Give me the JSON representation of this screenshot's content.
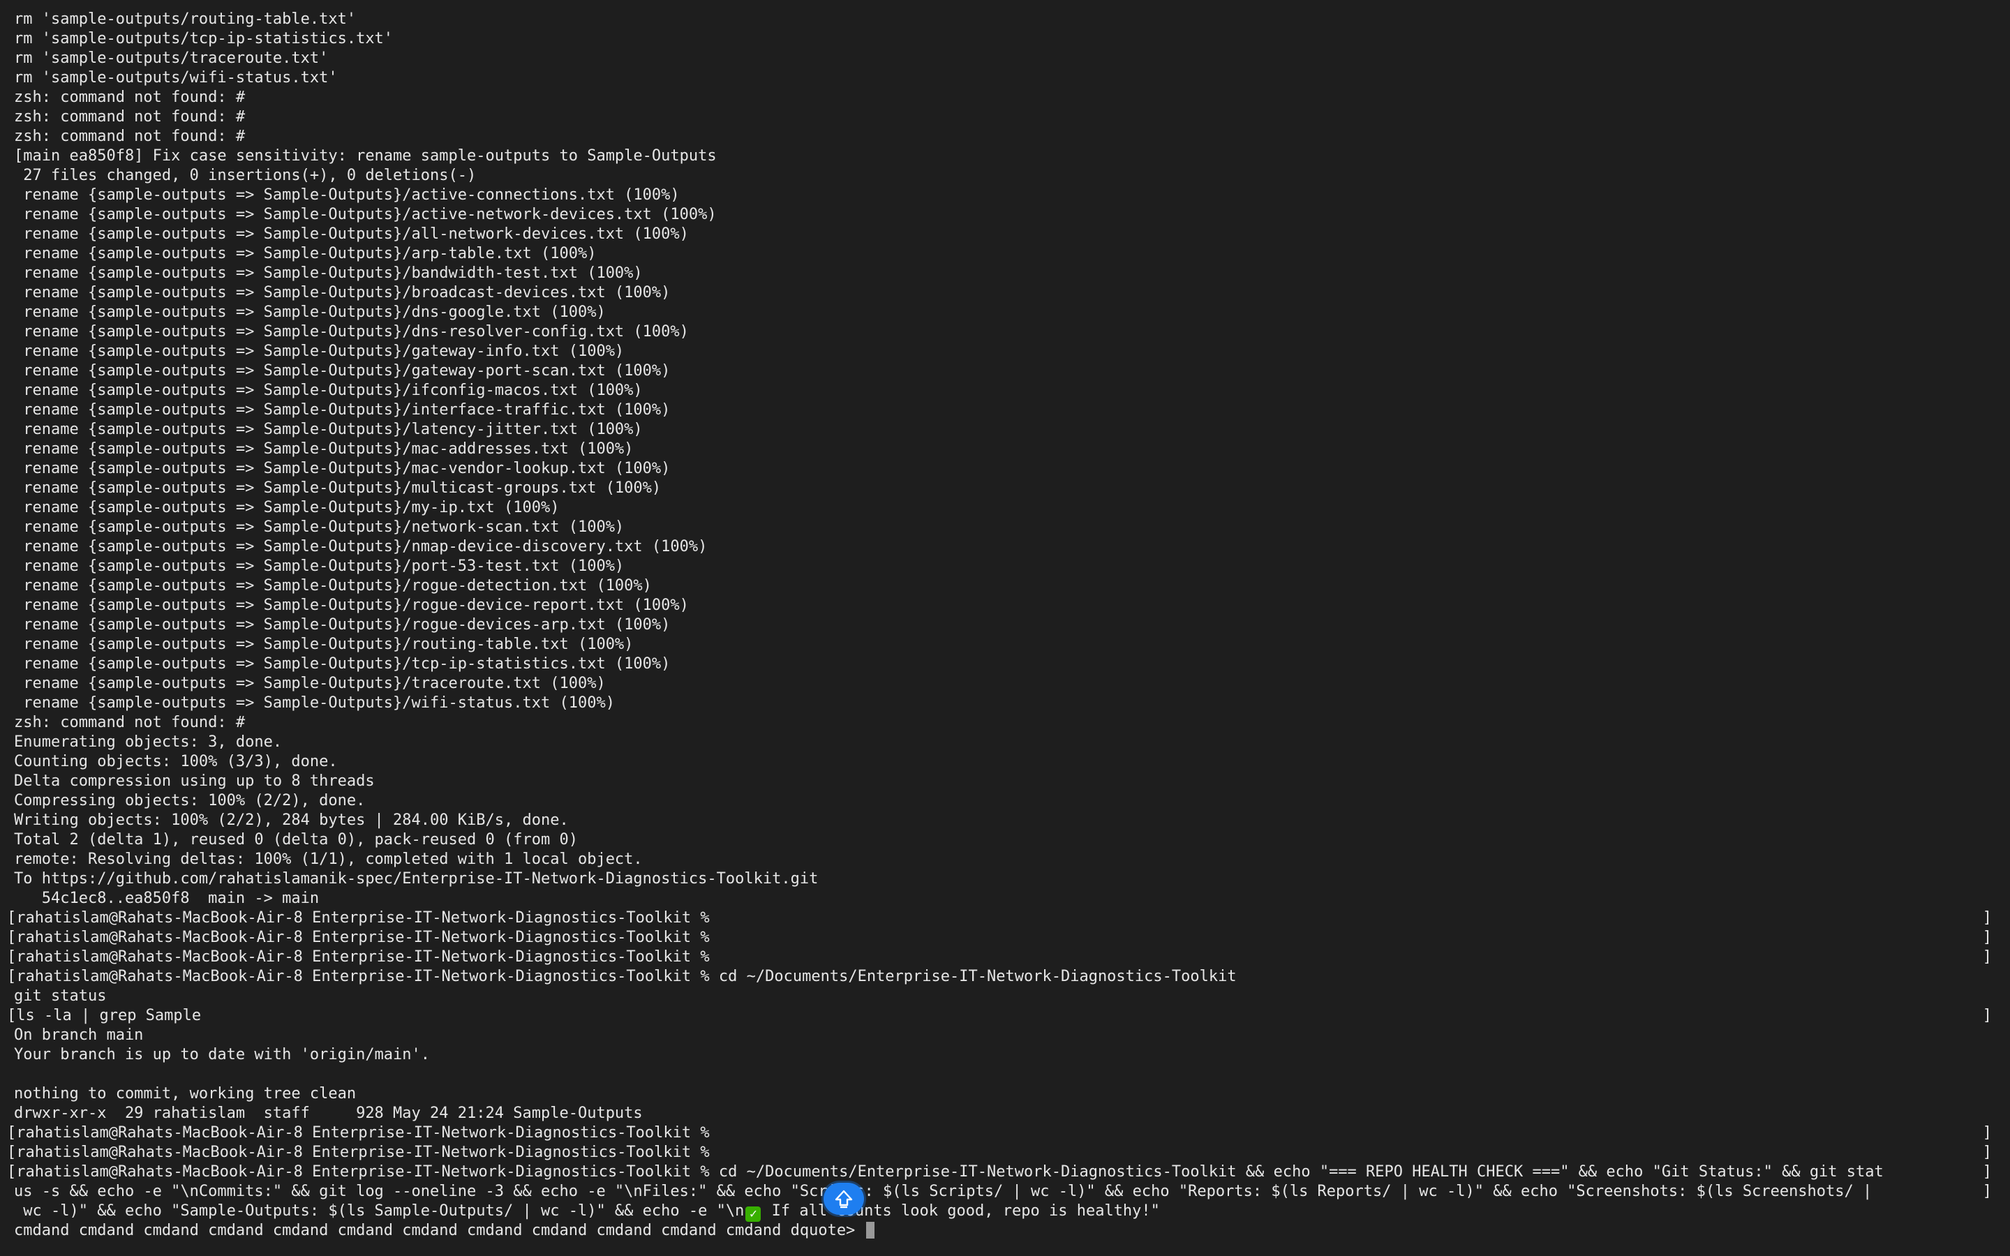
{
  "terminal": {
    "lines": [
      "rm 'sample-outputs/routing-table.txt'",
      "rm 'sample-outputs/tcp-ip-statistics.txt'",
      "rm 'sample-outputs/traceroute.txt'",
      "rm 'sample-outputs/wifi-status.txt'",
      "zsh: command not found: #",
      "zsh: command not found: #",
      "zsh: command not found: #",
      "[main ea850f8] Fix case sensitivity: rename sample-outputs to Sample-Outputs",
      " 27 files changed, 0 insertions(+), 0 deletions(-)",
      " rename {sample-outputs => Sample-Outputs}/active-connections.txt (100%)",
      " rename {sample-outputs => Sample-Outputs}/active-network-devices.txt (100%)",
      " rename {sample-outputs => Sample-Outputs}/all-network-devices.txt (100%)",
      " rename {sample-outputs => Sample-Outputs}/arp-table.txt (100%)",
      " rename {sample-outputs => Sample-Outputs}/bandwidth-test.txt (100%)",
      " rename {sample-outputs => Sample-Outputs}/broadcast-devices.txt (100%)",
      " rename {sample-outputs => Sample-Outputs}/dns-google.txt (100%)",
      " rename {sample-outputs => Sample-Outputs}/dns-resolver-config.txt (100%)",
      " rename {sample-outputs => Sample-Outputs}/gateway-info.txt (100%)",
      " rename {sample-outputs => Sample-Outputs}/gateway-port-scan.txt (100%)",
      " rename {sample-outputs => Sample-Outputs}/ifconfig-macos.txt (100%)",
      " rename {sample-outputs => Sample-Outputs}/interface-traffic.txt (100%)",
      " rename {sample-outputs => Sample-Outputs}/latency-jitter.txt (100%)",
      " rename {sample-outputs => Sample-Outputs}/mac-addresses.txt (100%)",
      " rename {sample-outputs => Sample-Outputs}/mac-vendor-lookup.txt (100%)",
      " rename {sample-outputs => Sample-Outputs}/multicast-groups.txt (100%)",
      " rename {sample-outputs => Sample-Outputs}/my-ip.txt (100%)",
      " rename {sample-outputs => Sample-Outputs}/network-scan.txt (100%)",
      " rename {sample-outputs => Sample-Outputs}/nmap-device-discovery.txt (100%)",
      " rename {sample-outputs => Sample-Outputs}/port-53-test.txt (100%)",
      " rename {sample-outputs => Sample-Outputs}/rogue-detection.txt (100%)",
      " rename {sample-outputs => Sample-Outputs}/rogue-device-report.txt (100%)",
      " rename {sample-outputs => Sample-Outputs}/rogue-devices-arp.txt (100%)",
      " rename {sample-outputs => Sample-Outputs}/routing-table.txt (100%)",
      " rename {sample-outputs => Sample-Outputs}/tcp-ip-statistics.txt (100%)",
      " rename {sample-outputs => Sample-Outputs}/traceroute.txt (100%)",
      " rename {sample-outputs => Sample-Outputs}/wifi-status.txt (100%)",
      "zsh: command not found: #",
      "Enumerating objects: 3, done.",
      "Counting objects: 100% (3/3), done.",
      "Delta compression using up to 8 threads",
      "Compressing objects: 100% (2/2), done.",
      "Writing objects: 100% (2/2), 284 bytes | 284.00 KiB/s, done.",
      "Total 2 (delta 1), reused 0 (delta 0), pack-reused 0 (from 0)",
      "remote: Resolving deltas: 100% (1/1), completed with 1 local object.",
      "To https://github.com/rahatislamanik-spec/Enterprise-IT-Network-Diagnostics-Toolkit.git",
      "   54c1ec8..ea850f8  main -> main"
    ],
    "prompt": "rahatislam@Rahats-MacBook-Air-8 Enterprise-IT-Network-Diagnostics-Toolkit % ",
    "empty_prompts_1": [
      "",
      "",
      ""
    ],
    "cd_command": "cd ~/Documents/Enterprise-IT-Network-Diagnostics-Toolkit",
    "git_status_cmd": "git status",
    "ls_cmd": "ls -la | grep Sample",
    "status_lines": [
      "On branch main",
      "Your branch is up to date with 'origin/main'.",
      "",
      "nothing to commit, working tree clean",
      "drwxr-xr-x  29 rahatislam  staff     928 May 24 21:24 Sample-Outputs"
    ],
    "health_cmd_line1": "cd ~/Documents/Enterprise-IT-Network-Diagnostics-Toolkit && echo \"=== REPO HEALTH CHECK ===\" && echo \"Git Status:\" && git stat",
    "health_cmd_line2": "us -s && echo -e \"\\nCommits:\" && git log --oneline -3 && echo -e \"\\nFiles:\" && echo \"Scripts: $(ls Scripts/ | wc -l)\" && echo \"Reports: $(ls Reports/ | wc -l)\" && echo \"Screenshots: $(ls Screenshots/ |",
    "health_cmd_line3_a": " wc -l)\" && echo \"Sample-Outputs: $(ls Sample-Outputs/ | wc -l)\" && echo -e \"\\n",
    "health_cmd_line3_b": " If all counts look good, repo is healthy!\"",
    "checkmark_glyph": "✓",
    "continuation": "cmdand cmdand cmdand cmdand cmdand cmdand cmdand cmdand cmdand cmdand cmdand cmdand dquote> ",
    "bracket_left": "[",
    "bracket_right": "]"
  },
  "overlay": {
    "icon": "shift-arrow-icon",
    "color": "#1e7ef0"
  }
}
